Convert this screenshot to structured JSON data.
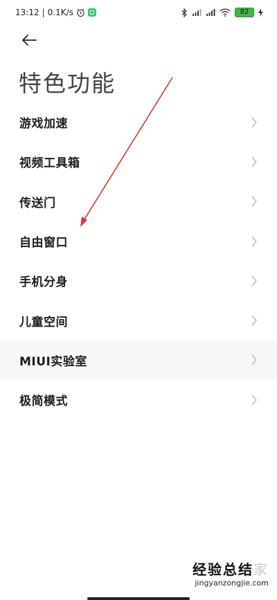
{
  "status_bar": {
    "time": "13:12",
    "separator": "|",
    "net_speed": "0.1K/s",
    "battery": "82",
    "icons": [
      "alarm-icon",
      "wechat-icon",
      "bluetooth-icon",
      "signal-icon",
      "signal-hd-icon",
      "wifi-icon",
      "battery-icon",
      "charging-icon"
    ],
    "battery_color": "#41b649"
  },
  "header": {
    "back_icon": "arrow-left-icon",
    "title": "特色功能"
  },
  "menu": {
    "items": [
      {
        "label": "游戏加速"
      },
      {
        "label": "视频工具箱"
      },
      {
        "label": "传送门"
      },
      {
        "label": "自由窗口"
      },
      {
        "label": "手机分身"
      },
      {
        "label": "儿童空间"
      },
      {
        "label": "MIUI实验室"
      },
      {
        "label": "极简模式"
      }
    ],
    "chevron_icon": "chevron-right-icon"
  },
  "annotation": {
    "color": "#d9342b",
    "target_item": "自由窗口"
  },
  "watermark": {
    "text_dark": "经验总结",
    "text_light": "家",
    "url": "jingyanzongjie.com"
  }
}
